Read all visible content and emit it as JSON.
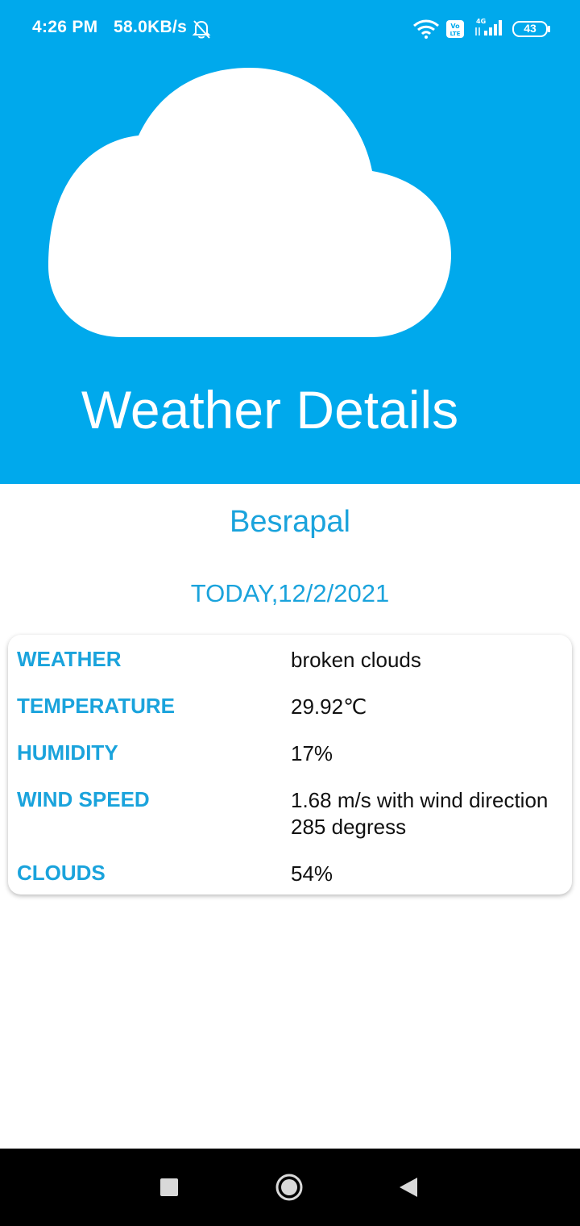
{
  "status_bar": {
    "time": "4:26 PM",
    "network_speed": "58.0KB/s",
    "battery_level": "43",
    "network_type": "4G",
    "volte_label": "Vo LTE"
  },
  "header": {
    "title": "Weather Details",
    "icon": "cloud-icon"
  },
  "location": {
    "city": "Besrapal",
    "date": "TODAY,12/2/2021"
  },
  "details": [
    {
      "label": "WEATHER",
      "value": "broken clouds"
    },
    {
      "label": "TEMPERATURE",
      "value": "29.92℃"
    },
    {
      "label": "HUMIDITY",
      "value": "17%"
    },
    {
      "label": "WIND SPEED",
      "value": "1.68 m/s with wind direction 285 degress"
    },
    {
      "label": "CLOUDS",
      "value": "54%"
    }
  ],
  "nav": {
    "recents": "recents-square-icon",
    "home": "home-circle-icon",
    "back": "back-triangle-icon"
  },
  "colors": {
    "header_bg": "#00a9ec",
    "accent_text": "#1aa3dc",
    "nav_bg": "#000000"
  }
}
